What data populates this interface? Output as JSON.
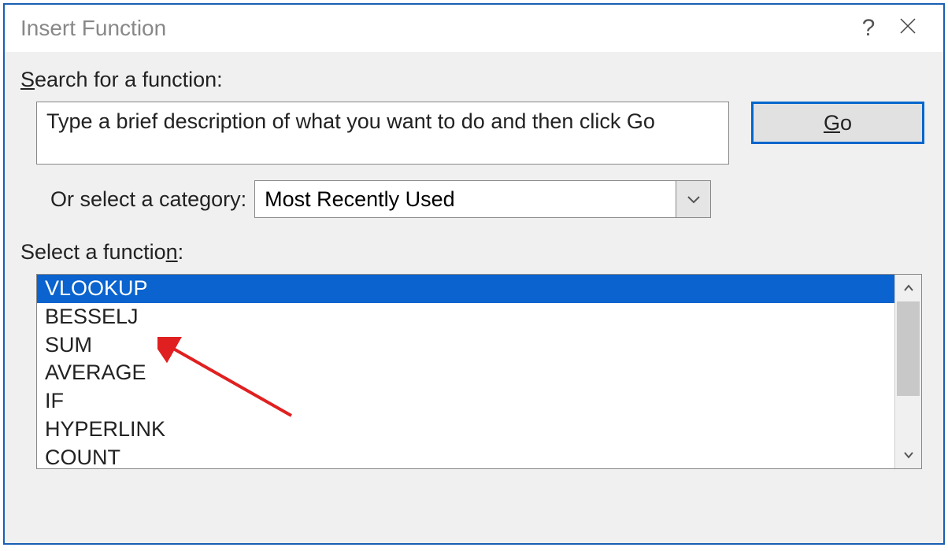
{
  "titlebar": {
    "title": "Insert Function",
    "help": "?",
    "close": "×"
  },
  "search": {
    "label_pre": "S",
    "label_post": "earch for a function:",
    "value": "Type a brief description of what you want to do and then click Go"
  },
  "go_button": {
    "mn": "G",
    "rest": "o"
  },
  "category": {
    "label_pre": "Or select a ",
    "label_mn": "c",
    "label_post": "ategory:",
    "selected": "Most Recently Used"
  },
  "select_function": {
    "label_pre": "Select a functio",
    "label_mn": "n",
    "label_post": ":"
  },
  "functions": [
    "VLOOKUP",
    "BESSELJ",
    "SUM",
    "AVERAGE",
    "IF",
    "HYPERLINK",
    "COUNT"
  ],
  "selected_index": 0
}
